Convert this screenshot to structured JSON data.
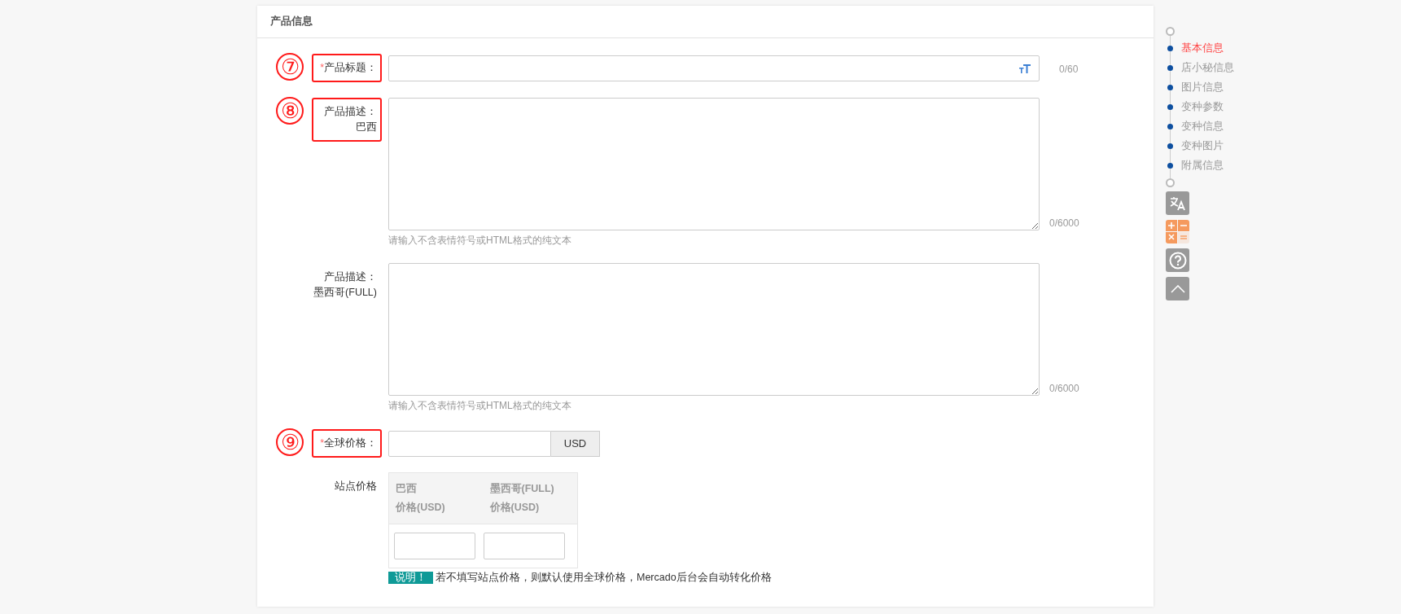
{
  "section": {
    "title": "产品信息"
  },
  "fields": [
    {
      "kind": "text",
      "marker": "⑦",
      "highlighted": true,
      "required_mark": "*",
      "label": [
        "产品标题："
      ],
      "counter": "0/60"
    },
    {
      "kind": "textarea",
      "marker": "⑧",
      "highlighted": true,
      "label": [
        "产品描述：",
        "巴西"
      ],
      "counter": "0/6000",
      "hint": "请输入不含表情符号或HTML格式的纯文本"
    },
    {
      "kind": "textarea",
      "highlighted": false,
      "label": [
        "产品描述：",
        "墨西哥(FULL)"
      ],
      "counter": "0/6000",
      "hint": "请输入不含表情符号或HTML格式的纯文本"
    },
    {
      "kind": "price",
      "marker": "⑨",
      "highlighted": true,
      "required_mark": "*",
      "label": [
        "全球价格："
      ],
      "unit": "USD"
    },
    {
      "kind": "site_price",
      "highlighted": false,
      "label": [
        "站点价格"
      ],
      "columns": [
        [
          "巴西",
          "价格(USD)"
        ],
        [
          "墨西哥(FULL)",
          "价格(USD)"
        ]
      ],
      "note_badge": "说明！",
      "note": "若不填写站点价格，则默认使用全球价格，Mercado后台会自动转化价格"
    }
  ],
  "nav": {
    "items": [
      {
        "label": "基本信息",
        "selected": true
      },
      {
        "label": "店小秘信息",
        "selected": false
      },
      {
        "label": "图片信息",
        "selected": false
      },
      {
        "label": "变种参数",
        "selected": false
      },
      {
        "label": "变种信息",
        "selected": false
      },
      {
        "label": "变种图片",
        "selected": false
      },
      {
        "label": "附属信息",
        "selected": false
      }
    ]
  }
}
